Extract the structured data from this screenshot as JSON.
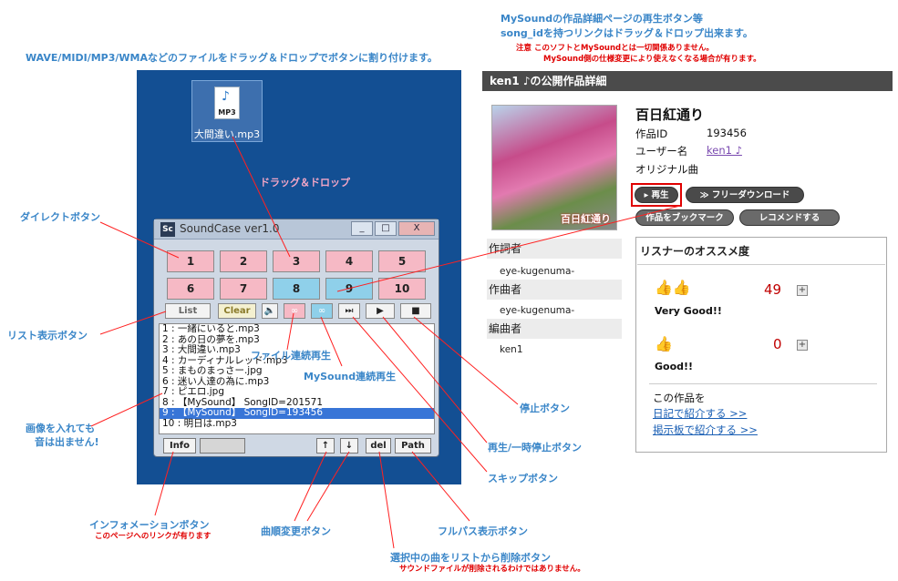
{
  "annotations": {
    "top_blue_1": "MySoundの作品詳細ページの再生ボタン等",
    "top_blue_2": "song_idを持つリンクはドラッグ＆ドロップ出来ます。",
    "top_red_1": "注意 このソフトとMySoundとは一切関係ありません。",
    "top_red_2": "MySound側の仕様変更により使えなくなる場合が有ります。",
    "left_top": "WAVE/MIDI/MP3/WMAなどのファイルをドラッグ＆ドロップでボタンに割り付けます。",
    "drag_drop": "ドラッグ＆ドロップ",
    "direct_button": "ダイレクトボタン",
    "list_button": "リスト表示ボタン",
    "image_note_1": "画像を入れても",
    "image_note_2": "音は出ません!",
    "file_continuous": "ファイル連続再生",
    "mysound_continuous": "MySound連続再生",
    "stop_button": "停止ボタン",
    "play_pause_button": "再生/一時停止ボタン",
    "skip_button": "スキップボタン",
    "info_button": "インフォメーションボタン",
    "info_note": "このページへのリンクが有ります",
    "order_button": "曲順変更ボタン",
    "fullpath_button": "フルパス表示ボタン",
    "delete_button": "選択中の曲をリストから削除ボタン",
    "delete_note": "サウンドファイルが削除されるわけではありません。"
  },
  "desktop": {
    "file_name": "大間違い.mp3",
    "file_type": "MP3"
  },
  "soundcase": {
    "title": "SoundCase ver1.0",
    "logo": "Sc",
    "window_buttons": [
      "_",
      "□",
      "X"
    ],
    "grid": [
      {
        "label": "1",
        "color": "pink"
      },
      {
        "label": "2",
        "color": "pink"
      },
      {
        "label": "3",
        "color": "pink"
      },
      {
        "label": "4",
        "color": "pink"
      },
      {
        "label": "5",
        "color": "pink"
      },
      {
        "label": "6",
        "color": "pink"
      },
      {
        "label": "7",
        "color": "pink"
      },
      {
        "label": "8",
        "color": "blue"
      },
      {
        "label": "9",
        "color": "blue"
      },
      {
        "label": "10",
        "color": "pink"
      }
    ],
    "list_label": "List",
    "clear_label": "Clear",
    "list_items": [
      "1 : 一緒にいると.mp3",
      "2 : あの日の夢を.mp3",
      "3 : 大間違い.mp3",
      "4 : カーディナルレッド.mp3",
      "5 : まものまっさー.jpg",
      "6 : 迷い人達の為に.mp3",
      "7 : ピエロ.jpg",
      "8 : 【MySound】 SongID=201571",
      "9 : 【MySound】 SongID=193456",
      "10 : 明日は.mp3"
    ],
    "selected_index": 8,
    "info_label": "Info",
    "up_label": "↑",
    "down_label": "↓",
    "del_label": "del",
    "path_label": "Path"
  },
  "detail": {
    "header": "ken1 ♪の公開作品詳細",
    "thumb_caption": "百日紅通り",
    "song_title": "百日紅通り",
    "id_label": "作品ID",
    "id_value": "193456",
    "user_label": "ユーザー名",
    "user_value": "ken1 ♪",
    "original": "オリジナル曲",
    "play_label": "▸ 再生",
    "download_label": "≫ フリーダウンロード",
    "bookmark_label": "作品をブックマーク",
    "recommend_label": "レコメンドする",
    "lyricist_label": "作詞者",
    "lyricist_value": "eye-kugenuma-",
    "composer_label": "作曲者",
    "composer_value": "eye-kugenuma-",
    "arranger_label": "編曲者",
    "arranger_value": "ken1"
  },
  "recommend": {
    "title": "リスナーのオススメ度",
    "very_good_count": "49",
    "very_good_label": "Very Good!!",
    "good_count": "0",
    "good_label": "Good!!",
    "share_title": "この作品を",
    "diary_link": "日記で紹介する >>",
    "board_link": "掲示板で紹介する >>"
  }
}
